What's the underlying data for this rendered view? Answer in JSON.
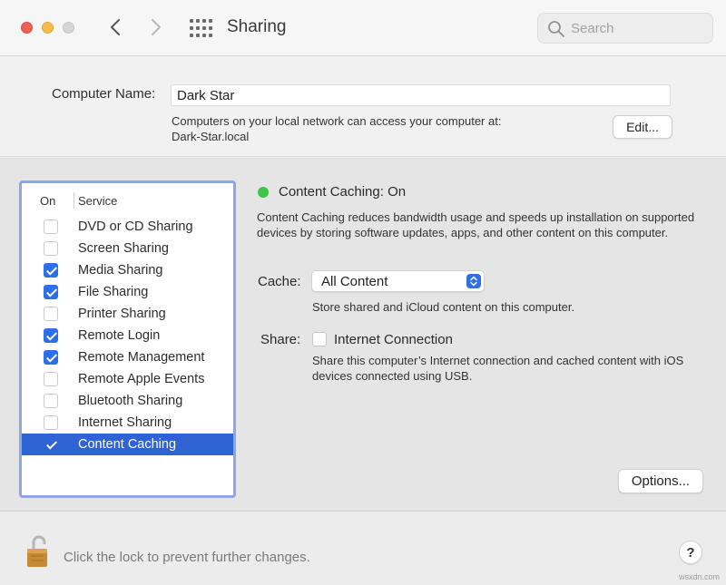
{
  "window": {
    "title": "Sharing",
    "search": {
      "placeholder": "Search",
      "value": ""
    }
  },
  "computer": {
    "label": "Computer Name:",
    "name": "Dark Star",
    "info_line1": "Computers on your local network can access your computer at:",
    "info_line2": "Dark-Star.local",
    "edit_label": "Edit..."
  },
  "services": {
    "header_on": "On",
    "header_service": "Service",
    "items": [
      {
        "label": "DVD or CD Sharing",
        "on": false
      },
      {
        "label": "Screen Sharing",
        "on": false
      },
      {
        "label": "Media Sharing",
        "on": true
      },
      {
        "label": "File Sharing",
        "on": true
      },
      {
        "label": "Printer Sharing",
        "on": false
      },
      {
        "label": "Remote Login",
        "on": true
      },
      {
        "label": "Remote Management",
        "on": true
      },
      {
        "label": "Remote Apple Events",
        "on": false
      },
      {
        "label": "Bluetooth Sharing",
        "on": false
      },
      {
        "label": "Internet Sharing",
        "on": false
      },
      {
        "label": "Content Caching",
        "on": true,
        "selected": true
      }
    ]
  },
  "detail": {
    "status": "Content Caching: On",
    "status_color": "#3ec545",
    "description": "Content Caching reduces bandwidth usage and speeds up installation on supported devices by storing software updates, apps, and other content on this computer.",
    "cache_label": "Cache:",
    "cache_value": "All Content",
    "cache_note": "Store shared and iCloud content on this computer.",
    "share_label": "Share:",
    "share_option": "Internet Connection",
    "share_checked": false,
    "share_note": "Share this computer’s Internet connection and cached content with iOS devices connected using USB.",
    "options_label": "Options..."
  },
  "footer": {
    "lock_text": "Click the lock to prevent further changes.",
    "help_label": "?",
    "watermark": "wsxdn.com"
  },
  "colors": {
    "accent": "#2f63d4",
    "list_focus": "#8ba7ea"
  }
}
